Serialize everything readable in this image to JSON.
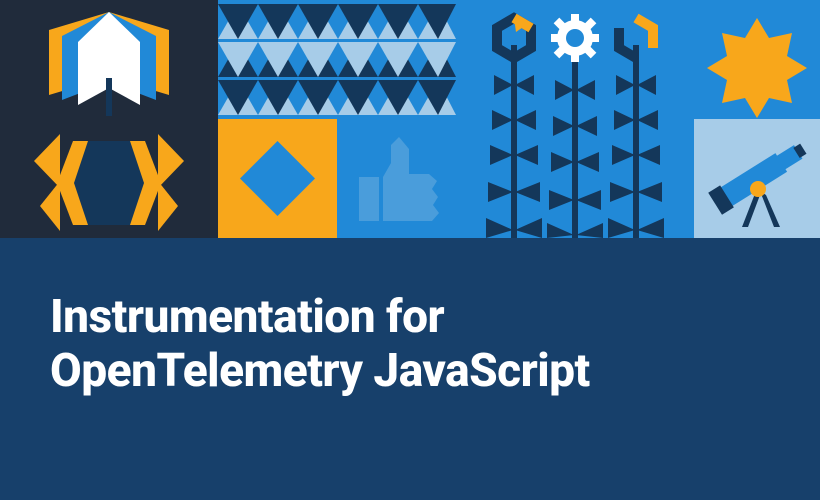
{
  "title": {
    "line1": "Instrumentation for",
    "line2": "OpenTelemetry JavaScript"
  },
  "colors": {
    "background": "#17406b",
    "dark": "#202b3b",
    "blue": "#2189d7",
    "lightblue": "#a7cce8",
    "orange": "#f8a71b",
    "white": "#ffffff",
    "navy": "#14375a"
  },
  "icons": {
    "tile1_top": "open-book",
    "tile1_bottom": "bee",
    "tile2_top": "triangles-pattern",
    "tile2_bottom_left": "diamond",
    "tile2_bottom_right": "thumbs-up",
    "tile3": "flowers",
    "tile4_top": "star-sun",
    "tile4_bottom": "telescope"
  }
}
